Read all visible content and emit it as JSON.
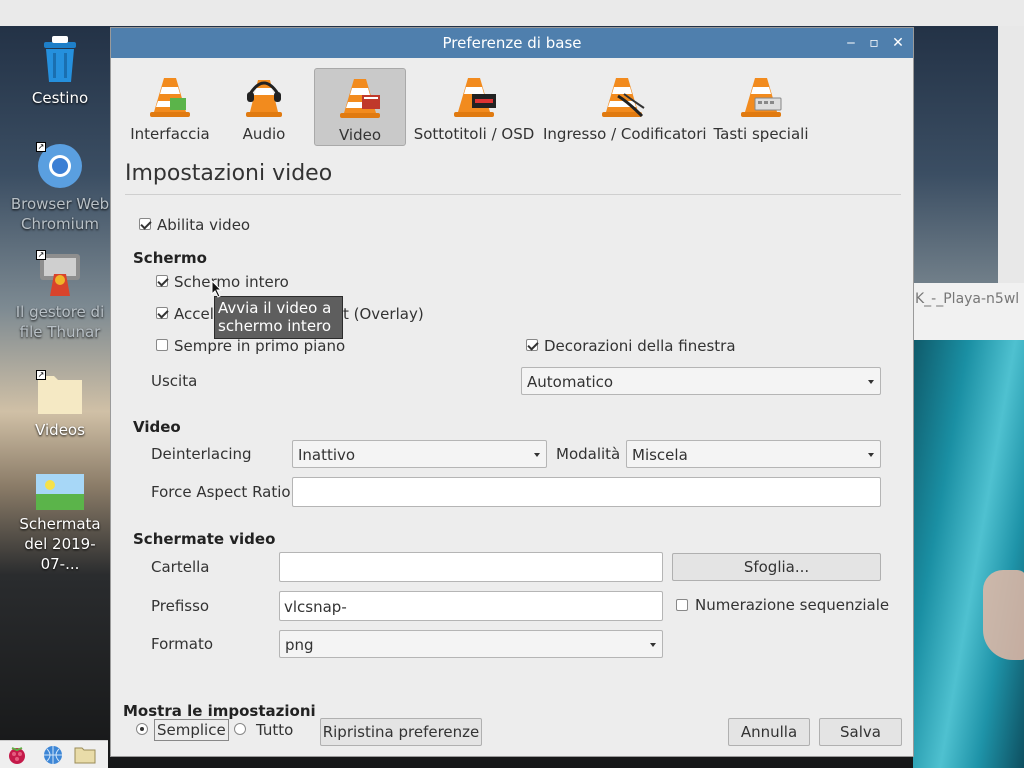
{
  "desktop": {
    "icons": [
      {
        "label": "Cestino"
      },
      {
        "label": "Browser Web Chromium"
      },
      {
        "label": "Il gestore di file Thunar"
      },
      {
        "label": "Videos"
      },
      {
        "label": "Schermata del 2019-07-..."
      }
    ],
    "background_window_title": "K_-_Playa-n5wl"
  },
  "dialog": {
    "title": "Preferenze di base",
    "categories": [
      {
        "label": "Interfaccia"
      },
      {
        "label": "Audio"
      },
      {
        "label": "Video",
        "selected": true
      },
      {
        "label": "Sottotitoli / OSD"
      },
      {
        "label": "Ingresso / Codificatori"
      },
      {
        "label": "Tasti speciali"
      }
    ],
    "section_title": "Impostazioni video",
    "enable_video": {
      "label": "Abilita video",
      "checked": true
    },
    "screen": {
      "header": "Schermo",
      "fullscreen": {
        "label": "Schermo intero",
        "checked": true
      },
      "accel": {
        "label": "Accelerated video output (Overlay)",
        "label_visible_start": "Accel",
        "label_visible_end": "t (Overlay)",
        "checked": true
      },
      "always_on_top": {
        "label": "Sempre in primo piano",
        "checked": false
      },
      "window_decorations": {
        "label": "Decorazioni della finestra",
        "checked": true
      },
      "output_label": "Uscita",
      "output_value": "Automatico"
    },
    "video": {
      "header": "Video",
      "deinterlacing_label": "Deinterlacing",
      "deinterlacing_value": "Inattivo",
      "mode_label": "Modalità",
      "mode_value": "Miscela",
      "aspect_label": "Force Aspect Ratio",
      "aspect_value": ""
    },
    "snapshots": {
      "header": "Schermate video",
      "folder_label": "Cartella",
      "folder_value": "",
      "browse_label": "Sfoglia...",
      "prefix_label": "Prefisso",
      "prefix_value": "vlcsnap-",
      "sequential": {
        "label": "Numerazione sequenziale",
        "checked": false
      },
      "format_label": "Formato",
      "format_value": "png"
    },
    "show_settings": {
      "header": "Mostra le impostazioni",
      "simple": "Semplice",
      "all": "Tutto",
      "selected": "simple"
    },
    "buttons": {
      "reset": "Ripristina preferenze",
      "cancel": "Annulla",
      "save": "Salva"
    },
    "tooltip": {
      "line1": "Avvia il video a",
      "line2": "schermo intero"
    }
  },
  "colors": {
    "titlebar": "#4f7fad",
    "dialog_bg": "#ededed",
    "selected_category": "#c9c9c9",
    "tooltip_bg": "#5e5e5e",
    "vlc_orange": "#f28b1e"
  }
}
